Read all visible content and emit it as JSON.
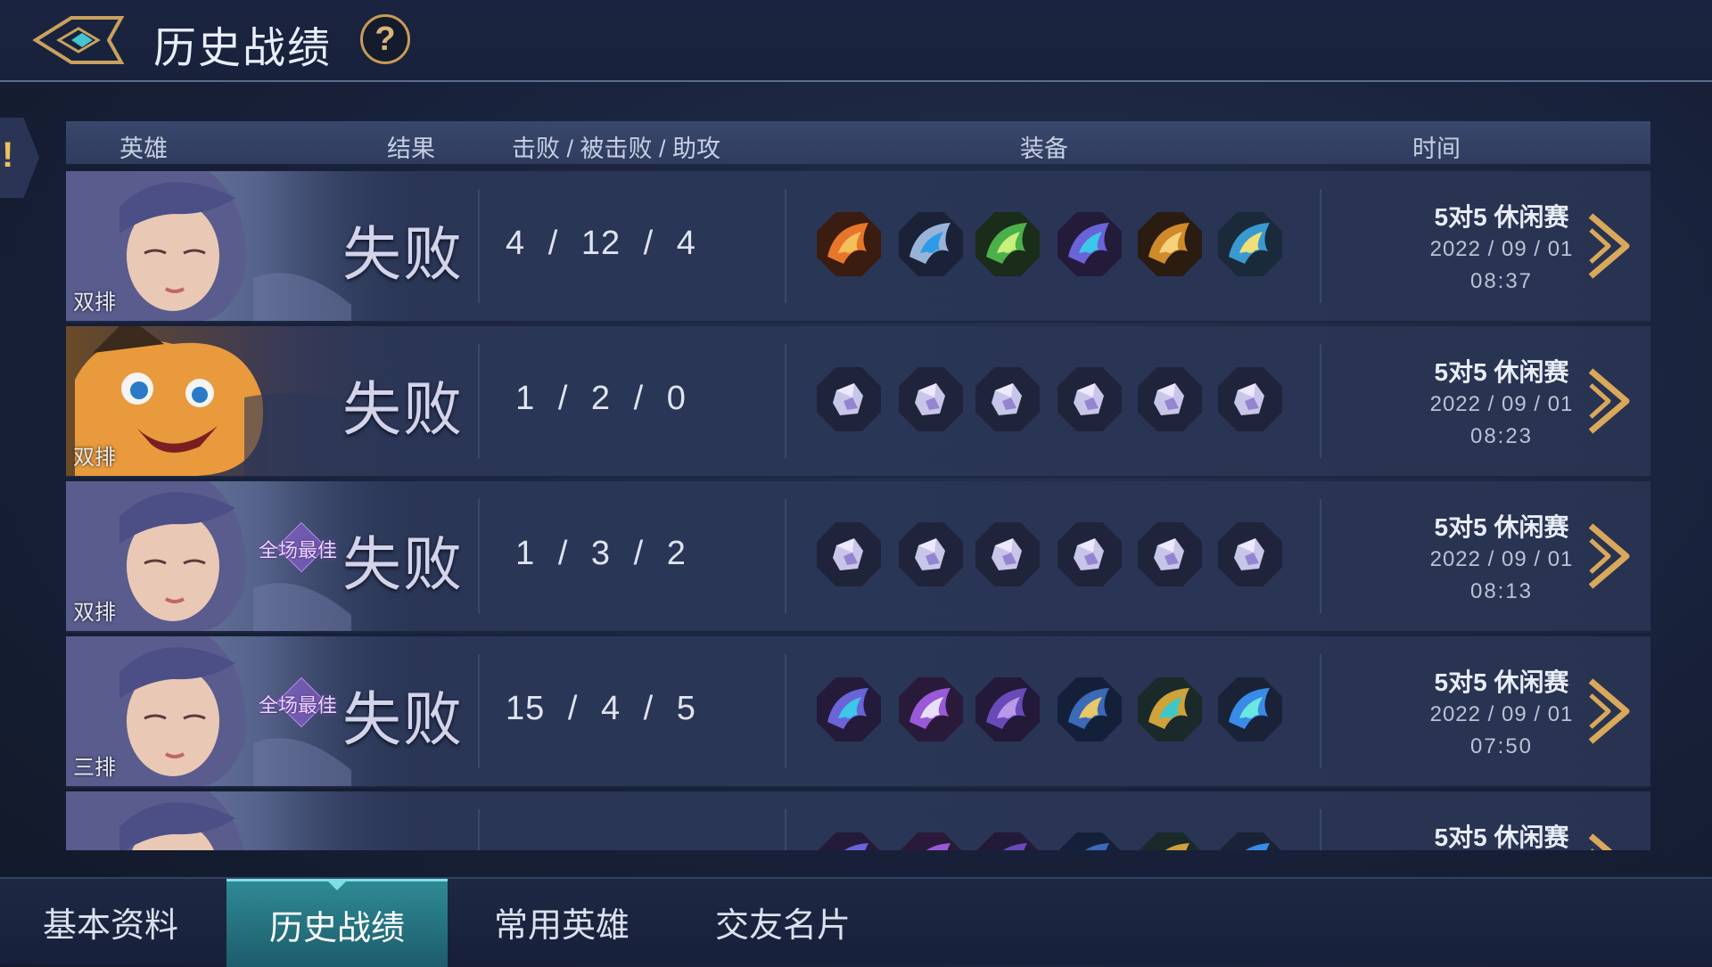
{
  "header": {
    "title": "历史战绩",
    "help_label": "?",
    "side_tab_label": "!"
  },
  "table": {
    "columns": {
      "hero": "英雄",
      "result": "结果",
      "kda": "击败 / 被击败 / 助攻",
      "equipment": "装备",
      "time": "时间"
    },
    "rows": [
      {
        "team_tag": "双排",
        "mvp": "",
        "result": "失败",
        "kda": "4 / 12 / 4",
        "mode": "5对5 休闲赛",
        "date": "2022 / 09 / 01",
        "time": "08:37",
        "hero": "hero-a",
        "items": [
          "flame-wing-item-icon",
          "eye-item-icon",
          "leaf-item-icon",
          "butterfly-item-icon",
          "golden-wing-item-icon",
          "ice-wing-item-icon"
        ]
      },
      {
        "team_tag": "双排",
        "mvp": "",
        "result": "失败",
        "kda": "1 / 2 / 0",
        "mode": "5对5 休闲赛",
        "date": "2022 / 09 / 01",
        "time": "08:23",
        "hero": "hero-b",
        "items": [
          "crystal-item-icon",
          "crystal-item-icon",
          "crystal-item-icon",
          "crystal-item-icon",
          "crystal-item-icon",
          "crystal-item-icon"
        ]
      },
      {
        "team_tag": "双排",
        "mvp": "全场最佳",
        "result": "失败",
        "kda": "1 / 3 / 2",
        "mode": "5对5 休闲赛",
        "date": "2022 / 09 / 01",
        "time": "08:13",
        "hero": "hero-a",
        "items": [
          "crystal-item-icon",
          "crystal-item-icon",
          "crystal-item-icon",
          "crystal-item-icon",
          "crystal-item-icon",
          "crystal-item-icon"
        ]
      },
      {
        "team_tag": "三排",
        "mvp": "全场最佳",
        "result": "失败",
        "kda": "15 / 4 / 5",
        "mode": "5对5 休闲赛",
        "date": "2022 / 09 / 01",
        "time": "07:50",
        "hero": "hero-a",
        "items": [
          "butterfly-item-icon",
          "scythe-item-icon",
          "shield-item-icon",
          "book-item-icon",
          "golden-orb-item-icon",
          "spear-wing-item-icon"
        ]
      },
      {
        "team_tag": "",
        "mvp": "",
        "result": "",
        "kda": "",
        "mode": "5对5 休闲赛",
        "date": "",
        "time": "",
        "hero": "hero-a",
        "items": [
          "butterfly-item-icon",
          "scythe-item-icon",
          "shield-item-icon",
          "book-item-icon",
          "golden-orb-item-icon",
          "spear-wing-item-icon"
        ]
      }
    ]
  },
  "bottom_nav": {
    "tabs": [
      "基本资料",
      "历史战绩",
      "常用英雄",
      "交友名片"
    ],
    "active_index": 1
  },
  "colors": {
    "accent": "#2f8a95",
    "gold": "#d7b37a",
    "row_bg": "#2b3757"
  }
}
